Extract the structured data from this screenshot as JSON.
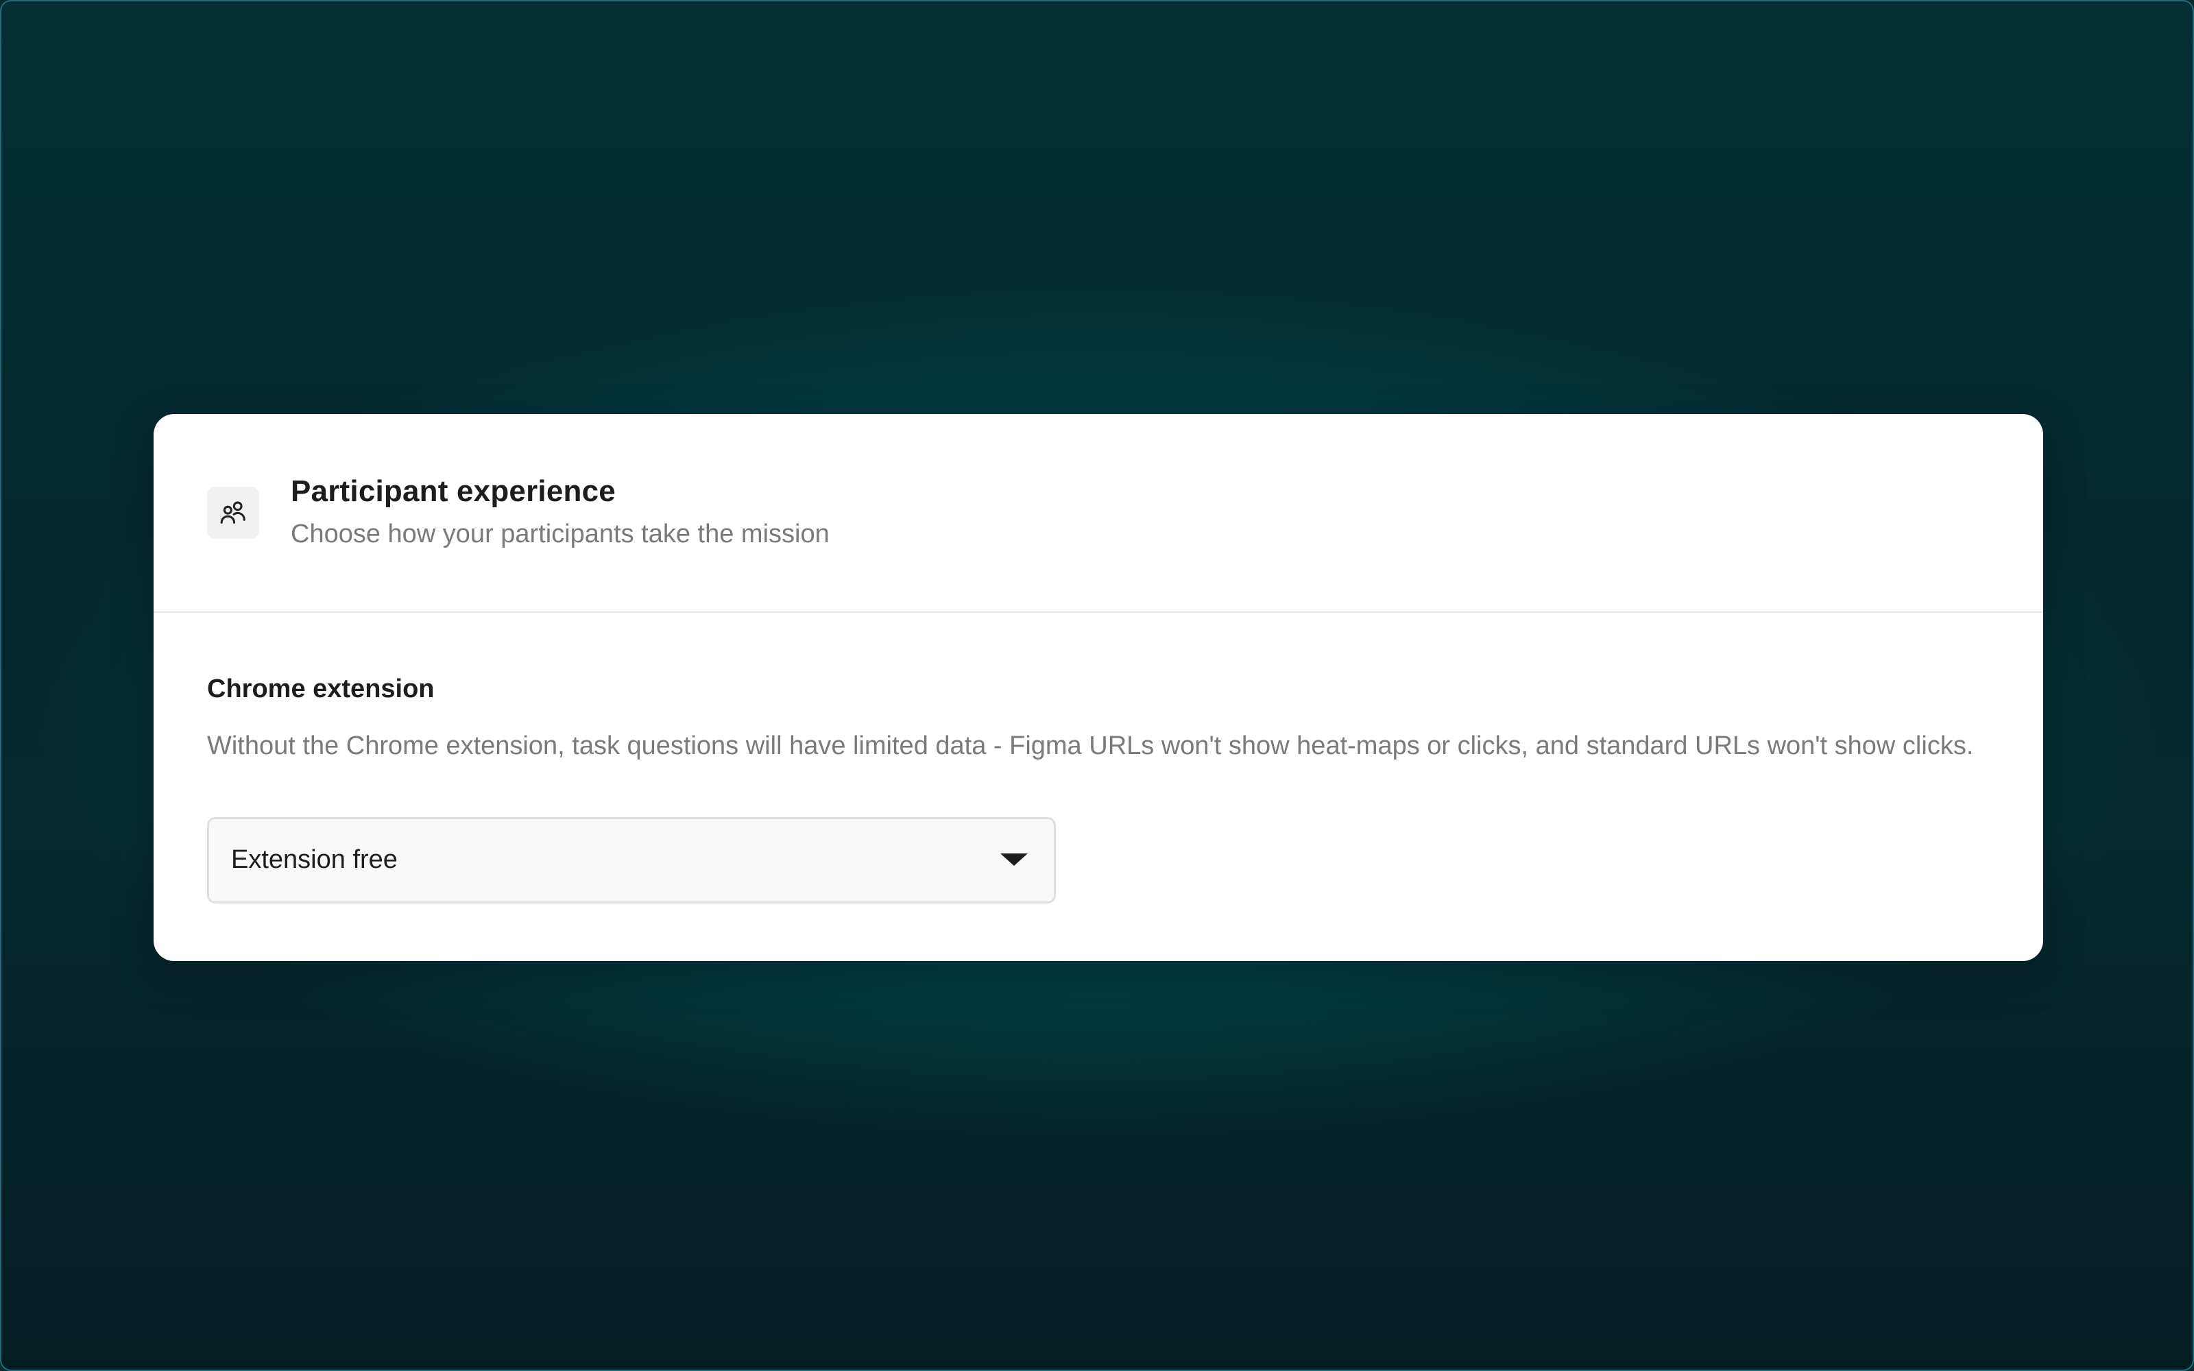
{
  "card": {
    "header": {
      "icon": "users-icon",
      "title": "Participant experience",
      "subtitle": "Choose how your participants take the mission"
    },
    "chrome_extension": {
      "label": "Chrome extension",
      "description": "Without the Chrome extension, task questions will have limited data - Figma URLs won't show heat-maps or clicks, and standard URLs won't show clicks.",
      "select": {
        "value": "Extension free",
        "icon": "chevron-down-icon"
      }
    }
  },
  "colors": {
    "background": "#05282e",
    "glow": "#005c66",
    "card": "#ffffff",
    "text_primary": "#1d1d1d",
    "text_secondary": "#7a7a7a"
  }
}
